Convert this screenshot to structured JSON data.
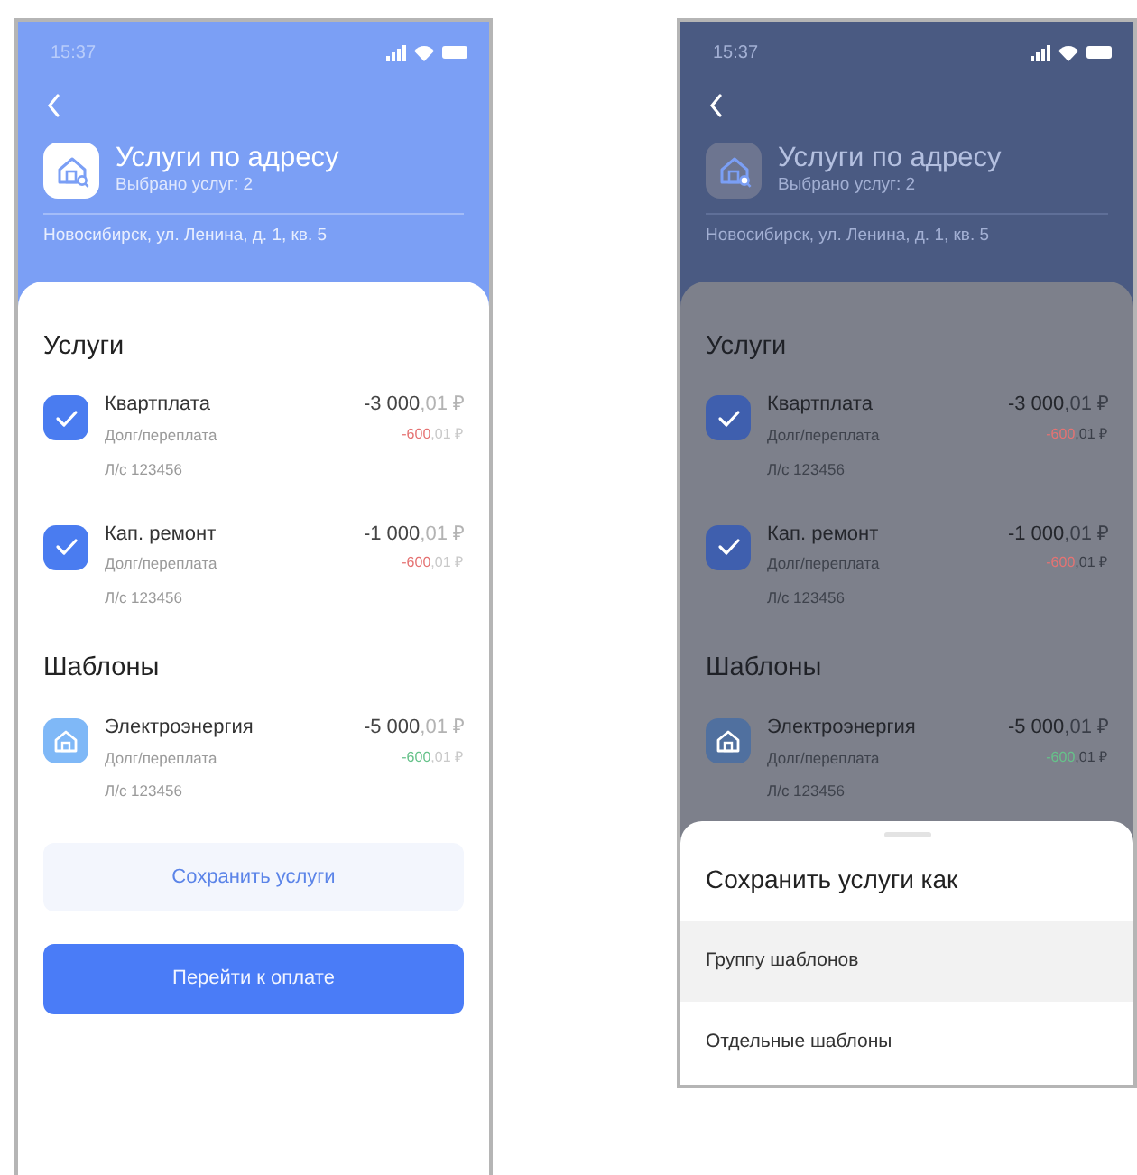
{
  "screens": [
    {
      "dimmed": false,
      "status_bar": {
        "time": "15:37"
      },
      "header": {
        "title": "Услуги по адресу",
        "subtitle": "Выбрано услуг: 2",
        "address": "Новосибирск, ул. Ленина, д. 1, кв. 5"
      },
      "sections": [
        {
          "title": "Услуги",
          "items": [
            {
              "kind": "checkbox",
              "checked": true,
              "name": "Квартплата",
              "note": "Долг/переплата",
              "account": "Л/с 123456",
              "amount": "-3 000",
              "amount_cents": ",01 ₽",
              "debt": "-600",
              "debt_cents": ",01 ₽",
              "color": "#e57373"
            },
            {
              "kind": "checkbox",
              "checked": true,
              "name": "Кап. ремонт",
              "note": "Долг/переплата",
              "account": "Л/с 123456",
              "amount": "-1 000",
              "amount_cents": ",01 ₽",
              "debt": "-600",
              "debt_cents": ",01 ₽",
              "color": "#e57373"
            }
          ]
        },
        {
          "title": "Шаблоны",
          "items": [
            {
              "kind": "template",
              "name": "Электроэнергия",
              "note": "Долг/переплата",
              "account": "Л/с 123456",
              "amount": "-5 000",
              "amount_cents": ",01 ₽",
              "debt": "-600",
              "debt_cents": ",01 ₽",
              "color": "#66c28a"
            }
          ]
        }
      ],
      "buttons": [
        {
          "kind": "secondary",
          "label": "Сохранить услуги"
        },
        {
          "kind": "primary",
          "label": "Перейти к оплате"
        }
      ]
    },
    {
      "dimmed": true,
      "status_bar": {
        "time": "15:37"
      },
      "header": {
        "title": "Услуги по адресу",
        "subtitle": "Выбрано услуг: 2",
        "address": "Новосибирск, ул. Ленина, д. 1, кв. 5"
      },
      "sections": [
        {
          "title": "Услуги",
          "items": [
            {
              "kind": "checkbox",
              "checked": true,
              "name": "Квартплата",
              "note": "Долг/переплата",
              "account": "Л/с 123456",
              "amount": "-3 000",
              "amount_cents": ",01 ₽",
              "debt": "-600",
              "debt_cents": ",01 ₽",
              "color": "#e57373"
            },
            {
              "kind": "checkbox",
              "checked": true,
              "name": "Кап. ремонт",
              "note": "Долг/переплата",
              "account": "Л/с 123456",
              "amount": "-1 000",
              "amount_cents": ",01 ₽",
              "debt": "-600",
              "debt_cents": ",01 ₽",
              "color": "#e57373"
            }
          ]
        },
        {
          "title": "Шаблоны",
          "items": [
            {
              "kind": "template",
              "name": "Электроэнергия",
              "note": "Долг/переплата",
              "account": "Л/с 123456",
              "amount": "-5 000",
              "amount_cents": ",01 ₽",
              "debt": "-600",
              "debt_cents": ",01 ₽",
              "color": "#66c28a"
            }
          ]
        }
      ],
      "sheet": {
        "title": "Сохранить услуги как",
        "options": [
          {
            "label": "Группу шаблонов",
            "selected": true
          },
          {
            "label": "Отдельные шаблоны",
            "selected": false
          }
        ]
      }
    }
  ]
}
